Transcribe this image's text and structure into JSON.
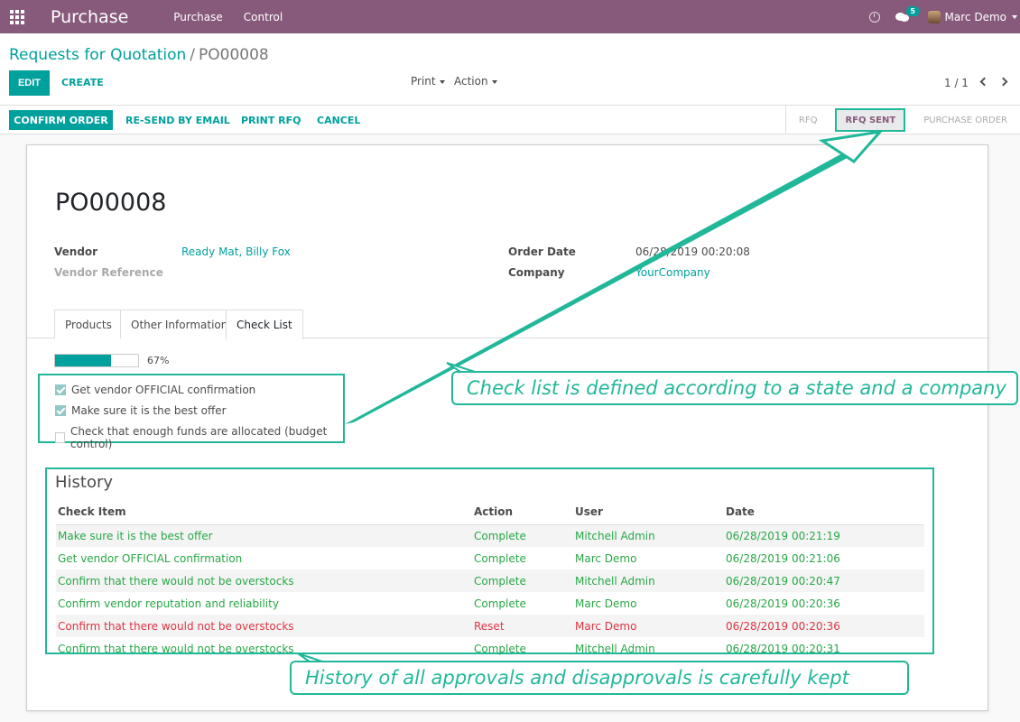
{
  "navbar": {
    "app_title": "Purchase",
    "menu": [
      "Purchase",
      "Control"
    ],
    "notification_count": "5",
    "user_name": "Marc Demo"
  },
  "control_panel": {
    "breadcrumb_parent": "Requests for Quotation",
    "breadcrumb_separator": "/",
    "breadcrumb_current": "PO00008",
    "edit_label": "EDIT",
    "create_label": "CREATE",
    "print_label": "Print",
    "action_label": "Action",
    "pager": "1 / 1"
  },
  "statusbar": {
    "buttons": [
      "CONFIRM ORDER",
      "RE-SEND BY EMAIL",
      "PRINT RFQ",
      "CANCEL"
    ],
    "stages": [
      "RFQ",
      "RFQ SENT",
      "PURCHASE ORDER"
    ],
    "active_stage": "RFQ SENT"
  },
  "record": {
    "title": "PO00008",
    "vendor_label": "Vendor",
    "vendor_value": "Ready Mat, Billy Fox",
    "vendor_reference_label": "Vendor Reference",
    "order_date_label": "Order Date",
    "order_date_value": "06/28/2019 00:20:08",
    "company_label": "Company",
    "company_value": "YourCompany"
  },
  "tabs": [
    "Products",
    "Other Information",
    "Check List"
  ],
  "active_tab": "Check List",
  "checklist": {
    "progress": 67,
    "progress_label": "67%",
    "items": [
      {
        "label": "Get vendor OFFICIAL confirmation",
        "checked": true
      },
      {
        "label": "Make sure it is the best offer",
        "checked": true
      },
      {
        "label": "Check that enough funds are allocated (budget control)",
        "checked": false
      }
    ]
  },
  "history": {
    "title": "History",
    "columns": [
      "Check Item",
      "Action",
      "User",
      "Date"
    ],
    "rows": [
      {
        "item": "Make sure it is the best offer",
        "action": "Complete",
        "user": "Mitchell Admin",
        "date": "06/28/2019 00:21:19",
        "color": "#28a745"
      },
      {
        "item": "Get vendor OFFICIAL confirmation",
        "action": "Complete",
        "user": "Marc Demo",
        "date": "06/28/2019 00:21:06",
        "color": "#28a745"
      },
      {
        "item": "Confirm that there would not be overstocks",
        "action": "Complete",
        "user": "Mitchell Admin",
        "date": "06/28/2019 00:20:47",
        "color": "#28a745"
      },
      {
        "item": "Confirm vendor reputation and reliability",
        "action": "Complete",
        "user": "Marc Demo",
        "date": "06/28/2019 00:20:36",
        "color": "#28a745"
      },
      {
        "item": "Confirm that there would not be overstocks",
        "action": "Reset",
        "user": "Marc Demo",
        "date": "06/28/2019 00:20:36",
        "color": "#dc3545"
      },
      {
        "item": "Confirm that there would not be overstocks",
        "action": "Complete",
        "user": "Mitchell Admin",
        "date": "06/28/2019 00:20:31",
        "color": "#28a745"
      }
    ]
  },
  "annotations": {
    "checklist_note": "Check list is defined according to a state and a company",
    "history_note": "History of all approvals and disapprovals is carefully kept"
  },
  "colors": {
    "brand": "#875a7b",
    "accent": "#00a09d",
    "annotation": "#21b799",
    "complete": "#28a745",
    "reset": "#dc3545"
  }
}
